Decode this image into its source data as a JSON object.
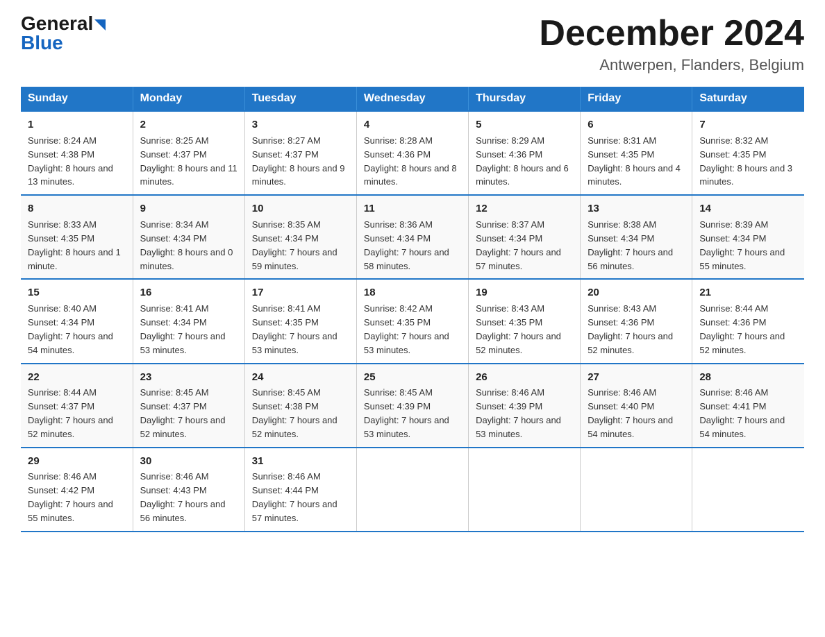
{
  "header": {
    "logo_general": "General",
    "logo_blue": "Blue",
    "month_title": "December 2024",
    "location": "Antwerpen, Flanders, Belgium"
  },
  "days_of_week": [
    "Sunday",
    "Monday",
    "Tuesday",
    "Wednesday",
    "Thursday",
    "Friday",
    "Saturday"
  ],
  "weeks": [
    [
      {
        "day": "1",
        "sunrise": "8:24 AM",
        "sunset": "4:38 PM",
        "daylight": "8 hours and 13 minutes."
      },
      {
        "day": "2",
        "sunrise": "8:25 AM",
        "sunset": "4:37 PM",
        "daylight": "8 hours and 11 minutes."
      },
      {
        "day": "3",
        "sunrise": "8:27 AM",
        "sunset": "4:37 PM",
        "daylight": "8 hours and 9 minutes."
      },
      {
        "day": "4",
        "sunrise": "8:28 AM",
        "sunset": "4:36 PM",
        "daylight": "8 hours and 8 minutes."
      },
      {
        "day": "5",
        "sunrise": "8:29 AM",
        "sunset": "4:36 PM",
        "daylight": "8 hours and 6 minutes."
      },
      {
        "day": "6",
        "sunrise": "8:31 AM",
        "sunset": "4:35 PM",
        "daylight": "8 hours and 4 minutes."
      },
      {
        "day": "7",
        "sunrise": "8:32 AM",
        "sunset": "4:35 PM",
        "daylight": "8 hours and 3 minutes."
      }
    ],
    [
      {
        "day": "8",
        "sunrise": "8:33 AM",
        "sunset": "4:35 PM",
        "daylight": "8 hours and 1 minute."
      },
      {
        "day": "9",
        "sunrise": "8:34 AM",
        "sunset": "4:34 PM",
        "daylight": "8 hours and 0 minutes."
      },
      {
        "day": "10",
        "sunrise": "8:35 AM",
        "sunset": "4:34 PM",
        "daylight": "7 hours and 59 minutes."
      },
      {
        "day": "11",
        "sunrise": "8:36 AM",
        "sunset": "4:34 PM",
        "daylight": "7 hours and 58 minutes."
      },
      {
        "day": "12",
        "sunrise": "8:37 AM",
        "sunset": "4:34 PM",
        "daylight": "7 hours and 57 minutes."
      },
      {
        "day": "13",
        "sunrise": "8:38 AM",
        "sunset": "4:34 PM",
        "daylight": "7 hours and 56 minutes."
      },
      {
        "day": "14",
        "sunrise": "8:39 AM",
        "sunset": "4:34 PM",
        "daylight": "7 hours and 55 minutes."
      }
    ],
    [
      {
        "day": "15",
        "sunrise": "8:40 AM",
        "sunset": "4:34 PM",
        "daylight": "7 hours and 54 minutes."
      },
      {
        "day": "16",
        "sunrise": "8:41 AM",
        "sunset": "4:34 PM",
        "daylight": "7 hours and 53 minutes."
      },
      {
        "day": "17",
        "sunrise": "8:41 AM",
        "sunset": "4:35 PM",
        "daylight": "7 hours and 53 minutes."
      },
      {
        "day": "18",
        "sunrise": "8:42 AM",
        "sunset": "4:35 PM",
        "daylight": "7 hours and 53 minutes."
      },
      {
        "day": "19",
        "sunrise": "8:43 AM",
        "sunset": "4:35 PM",
        "daylight": "7 hours and 52 minutes."
      },
      {
        "day": "20",
        "sunrise": "8:43 AM",
        "sunset": "4:36 PM",
        "daylight": "7 hours and 52 minutes."
      },
      {
        "day": "21",
        "sunrise": "8:44 AM",
        "sunset": "4:36 PM",
        "daylight": "7 hours and 52 minutes."
      }
    ],
    [
      {
        "day": "22",
        "sunrise": "8:44 AM",
        "sunset": "4:37 PM",
        "daylight": "7 hours and 52 minutes."
      },
      {
        "day": "23",
        "sunrise": "8:45 AM",
        "sunset": "4:37 PM",
        "daylight": "7 hours and 52 minutes."
      },
      {
        "day": "24",
        "sunrise": "8:45 AM",
        "sunset": "4:38 PM",
        "daylight": "7 hours and 52 minutes."
      },
      {
        "day": "25",
        "sunrise": "8:45 AM",
        "sunset": "4:39 PM",
        "daylight": "7 hours and 53 minutes."
      },
      {
        "day": "26",
        "sunrise": "8:46 AM",
        "sunset": "4:39 PM",
        "daylight": "7 hours and 53 minutes."
      },
      {
        "day": "27",
        "sunrise": "8:46 AM",
        "sunset": "4:40 PM",
        "daylight": "7 hours and 54 minutes."
      },
      {
        "day": "28",
        "sunrise": "8:46 AM",
        "sunset": "4:41 PM",
        "daylight": "7 hours and 54 minutes."
      }
    ],
    [
      {
        "day": "29",
        "sunrise": "8:46 AM",
        "sunset": "4:42 PM",
        "daylight": "7 hours and 55 minutes."
      },
      {
        "day": "30",
        "sunrise": "8:46 AM",
        "sunset": "4:43 PM",
        "daylight": "7 hours and 56 minutes."
      },
      {
        "day": "31",
        "sunrise": "8:46 AM",
        "sunset": "4:44 PM",
        "daylight": "7 hours and 57 minutes."
      },
      null,
      null,
      null,
      null
    ]
  ],
  "labels": {
    "sunrise": "Sunrise:",
    "sunset": "Sunset:",
    "daylight": "Daylight:"
  }
}
